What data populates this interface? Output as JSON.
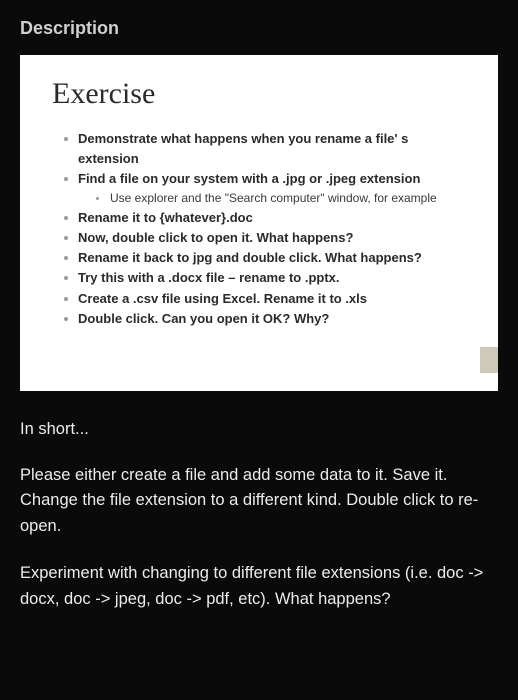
{
  "header": "Description",
  "slide": {
    "title": "Exercise",
    "bullets": [
      "Demonstrate what happens when you rename a file' s extension",
      "Find a file on your system with a .jpg or .jpeg extension",
      "Rename it to {whatever}.doc",
      "Now, double click to open it. What happens?",
      "Rename it back to jpg and double click. What happens?",
      "Try this with a .docx file – rename to .pptx.",
      "Create a .csv file using Excel. Rename it to .xls",
      "Double click. Can you open it OK? Why?"
    ],
    "sub_bullet": "Use explorer and the \"Search computer\" window, for example"
  },
  "body": {
    "in_short": "In short...",
    "p1": "Please either create a file and add some data to it. Save it. Change the file extension to a different kind. Double click to re-open.",
    "p2": "Experiment with changing to different file extensions (i.e. doc -> docx, doc -> jpeg, doc -> pdf, etc). What happens?"
  }
}
